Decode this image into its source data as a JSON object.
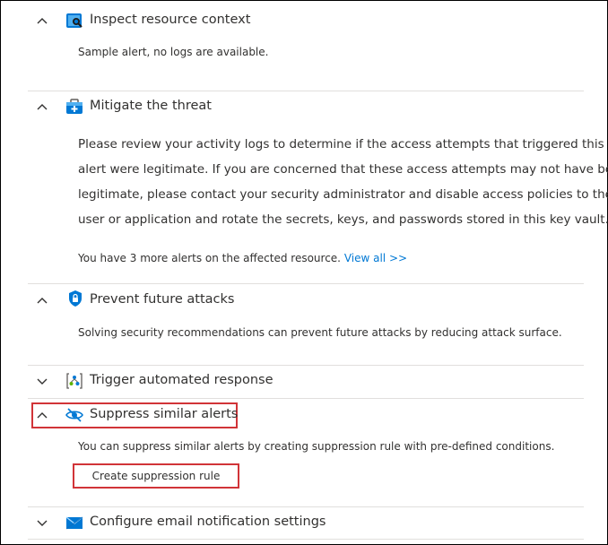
{
  "sections": {
    "inspect": {
      "title": "Inspect resource context",
      "body": "Sample alert, no logs are available.",
      "expanded": true
    },
    "mitigate": {
      "title": "Mitigate the threat",
      "paragraph_lines": [
        "Please review your activity logs to determine if the access attempts that triggered this",
        "alert were legitimate. If you are concerned that these access attempts may not have been",
        "legitimate, please contact your security administrator and disable access policies to the",
        "user or application and rotate the secrets, keys, and passwords stored in this key vault."
      ],
      "more_alerts_text": "You have 3 more alerts on the affected resource.",
      "view_all_label": "View all >>",
      "expanded": true
    },
    "prevent": {
      "title": "Prevent future attacks",
      "body": "Solving security recommendations can prevent future attacks by reducing attack surface.",
      "expanded": true
    },
    "trigger": {
      "title": "Trigger automated response",
      "expanded": false
    },
    "suppress": {
      "title": "Suppress similar alerts",
      "body": "You can suppress similar alerts by creating suppression rule with pre-defined conditions.",
      "button_label": "Create suppression rule",
      "expanded": true
    },
    "email": {
      "title": "Configure email notification settings",
      "expanded": false
    }
  },
  "colors": {
    "link": "#0078d4",
    "highlight": "#d13438",
    "divider": "#e1dfdd",
    "icon_blue": "#0078d4"
  },
  "icons": {
    "inspect": "inspect-resource-icon",
    "mitigate": "medkit-icon",
    "prevent": "shield-lock-icon",
    "trigger": "automation-icon",
    "suppress": "eye-hidden-icon",
    "email": "envelope-icon"
  }
}
